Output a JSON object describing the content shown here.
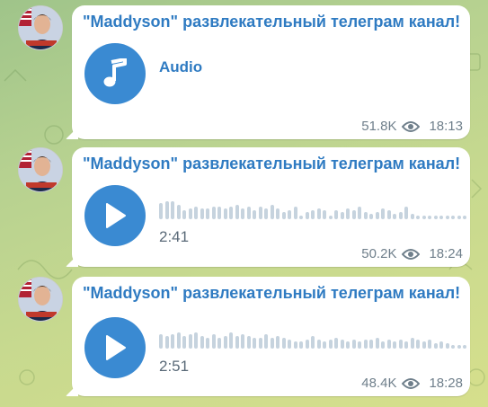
{
  "channel": {
    "name": "\"Maddyson\" развлекательный телеграм канал!"
  },
  "messages": [
    {
      "kind": "audio-file",
      "title": "Audio",
      "icon": "music-note-icon",
      "views": "51.8K",
      "time": "18:13"
    },
    {
      "kind": "voice",
      "icon": "play-icon",
      "duration": "2:41",
      "views": "50.2K",
      "time": "18:24",
      "waveform": [
        0.9,
        1,
        1,
        0.8,
        0.5,
        0.6,
        0.7,
        0.6,
        0.6,
        0.7,
        0.7,
        0.6,
        0.7,
        0.8,
        0.6,
        0.7,
        0.5,
        0.7,
        0.6,
        0.8,
        0.6,
        0.4,
        0.5,
        0.7,
        0.2,
        0.4,
        0.5,
        0.6,
        0.5,
        0.2,
        0.5,
        0.4,
        0.6,
        0.5,
        0.7,
        0.4,
        0.3,
        0.4,
        0.6,
        0.5,
        0.3,
        0.4,
        0.7,
        0.3,
        0.2,
        0.2,
        0.2,
        0.2,
        0.2,
        0.2,
        0.2,
        0.2,
        0.2
      ]
    },
    {
      "kind": "voice",
      "icon": "play-icon",
      "duration": "2:51",
      "views": "48.4K",
      "time": "18:28",
      "waveform": [
        0.8,
        0.7,
        0.8,
        0.9,
        0.7,
        0.8,
        0.9,
        0.7,
        0.6,
        0.8,
        0.6,
        0.7,
        0.9,
        0.7,
        0.8,
        0.7,
        0.6,
        0.6,
        0.8,
        0.6,
        0.7,
        0.6,
        0.5,
        0.4,
        0.4,
        0.5,
        0.7,
        0.5,
        0.4,
        0.5,
        0.6,
        0.5,
        0.4,
        0.5,
        0.4,
        0.5,
        0.5,
        0.6,
        0.4,
        0.5,
        0.4,
        0.5,
        0.4,
        0.6,
        0.5,
        0.4,
        0.5,
        0.3,
        0.4,
        0.3,
        0.2,
        0.2,
        0.2
      ]
    }
  ],
  "colors": {
    "accent": "#2f7bc2",
    "play_button": "#3a8ad2",
    "bubble": "#ffffff",
    "meta_text": "#6f7f8b"
  }
}
